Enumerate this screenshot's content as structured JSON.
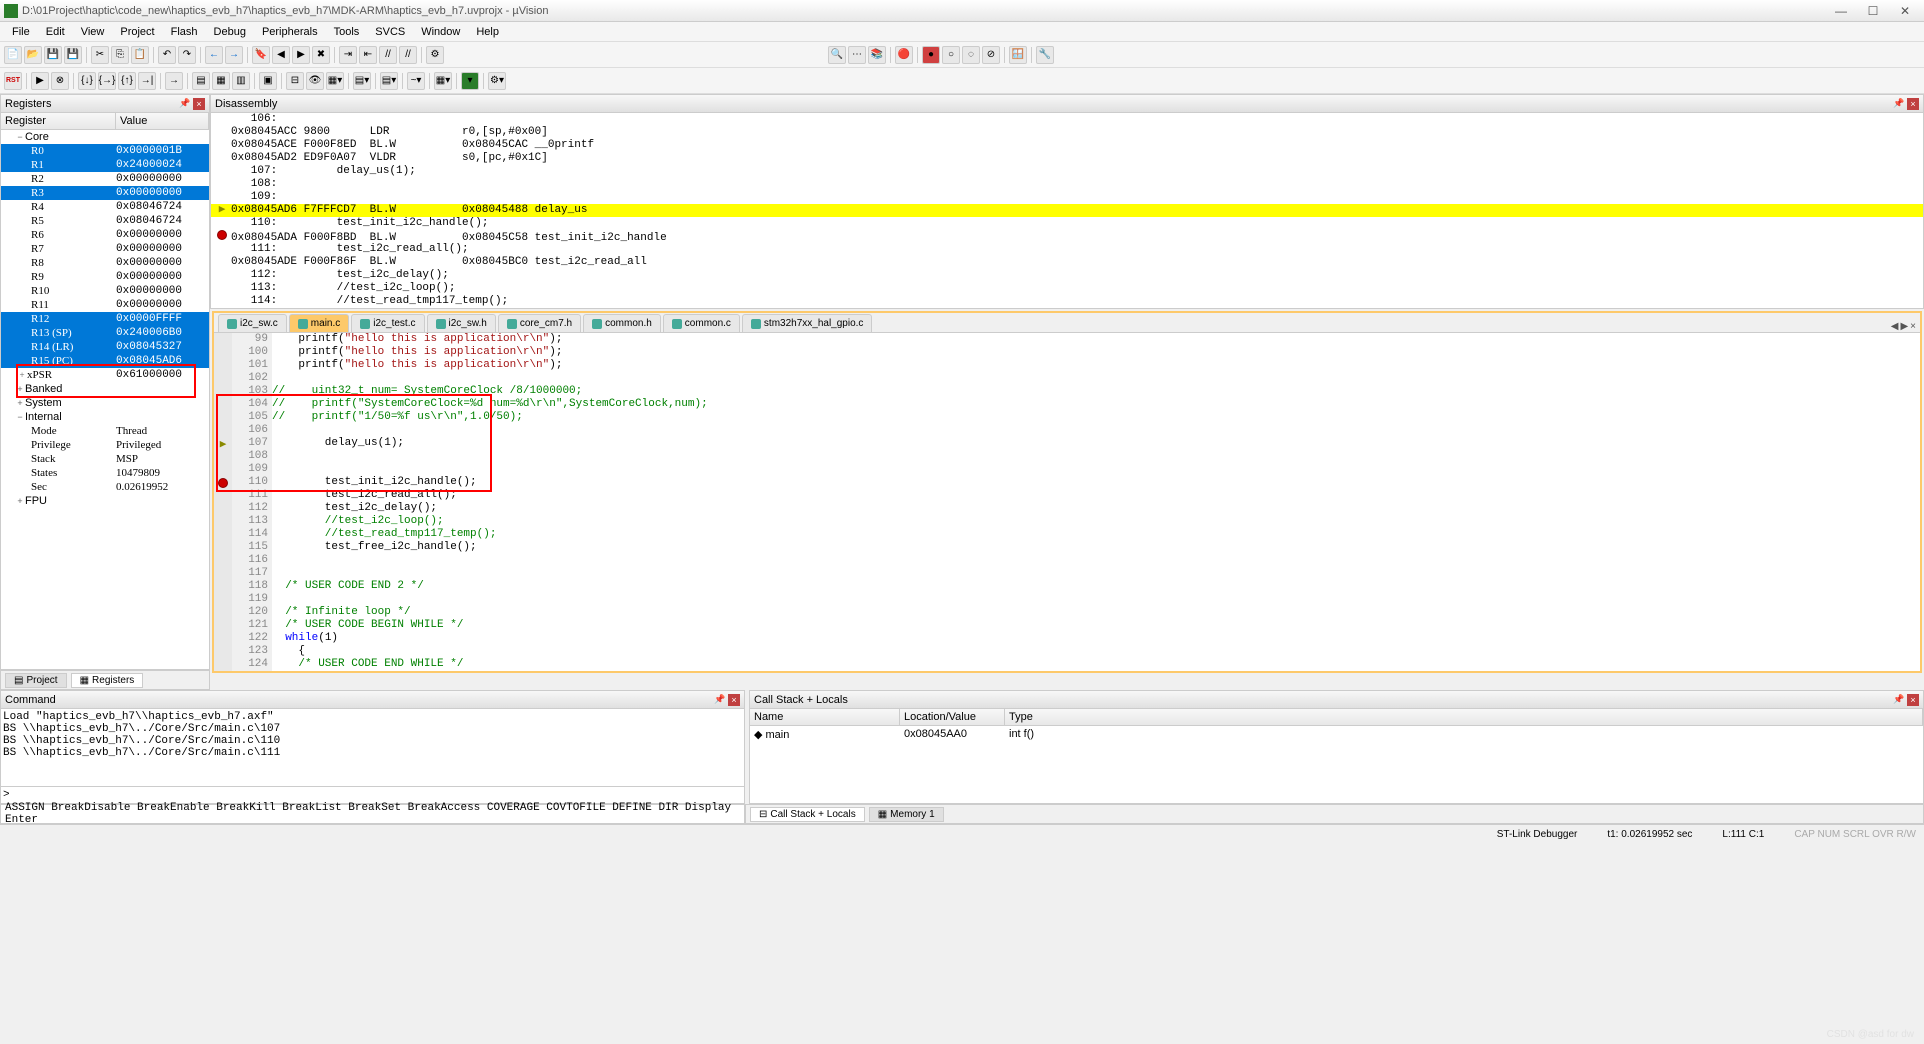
{
  "title": "D:\\01Project\\haptic\\code_new\\haptics_evb_h7\\haptics_evb_h7\\MDK-ARM\\haptics_evb_h7.uvprojx - µVision",
  "menu": [
    "File",
    "Edit",
    "View",
    "Project",
    "Flash",
    "Debug",
    "Peripherals",
    "Tools",
    "SVCS",
    "Window",
    "Help"
  ],
  "panels": {
    "registers": "Registers",
    "reg_col1": "Register",
    "reg_col2": "Value",
    "disassembly": "Disassembly",
    "command": "Command",
    "callstack": "Call Stack + Locals"
  },
  "reg_groups": {
    "core": "Core",
    "xpsr": "xPSR",
    "banked": "Banked",
    "system": "System",
    "internal": "Internal",
    "fpu": "FPU"
  },
  "registers": [
    {
      "name": "R0",
      "val": "0x0000001B",
      "sel": true
    },
    {
      "name": "R1",
      "val": "0x24000024",
      "sel": true
    },
    {
      "name": "R2",
      "val": "0x00000000",
      "sel": false
    },
    {
      "name": "R3",
      "val": "0x00000000",
      "sel": true
    },
    {
      "name": "R4",
      "val": "0x08046724",
      "sel": false
    },
    {
      "name": "R5",
      "val": "0x08046724",
      "sel": false
    },
    {
      "name": "R6",
      "val": "0x00000000",
      "sel": false
    },
    {
      "name": "R7",
      "val": "0x00000000",
      "sel": false
    },
    {
      "name": "R8",
      "val": "0x00000000",
      "sel": false
    },
    {
      "name": "R9",
      "val": "0x00000000",
      "sel": false
    },
    {
      "name": "R10",
      "val": "0x00000000",
      "sel": false
    },
    {
      "name": "R11",
      "val": "0x00000000",
      "sel": false
    },
    {
      "name": "R12",
      "val": "0x0000FFFF",
      "sel": true
    },
    {
      "name": "R13 (SP)",
      "val": "0x240006B0",
      "sel": true
    },
    {
      "name": "R14 (LR)",
      "val": "0x08045327",
      "sel": true
    },
    {
      "name": "R15 (PC)",
      "val": "0x08045AD6",
      "sel": true
    }
  ],
  "xpsr_val": "0x61000000",
  "internal": [
    {
      "name": "Mode",
      "val": "Thread"
    },
    {
      "name": "Privilege",
      "val": "Privileged"
    },
    {
      "name": "Stack",
      "val": "MSP"
    },
    {
      "name": "States",
      "val": "10479809"
    },
    {
      "name": "Sec",
      "val": "0.02619952"
    }
  ],
  "disasm": [
    {
      "txt": "   106:",
      "cls": ""
    },
    {
      "txt": "0x08045ACC 9800      LDR           r0,[sp,#0x00]",
      "cls": ""
    },
    {
      "txt": "0x08045ACE F000F8ED  BL.W          0x08045CAC __0printf",
      "cls": ""
    },
    {
      "txt": "0x08045AD2 ED9F0A07  VLDR          s0,[pc,#0x1C]",
      "cls": ""
    },
    {
      "txt": "   107:         delay_us(1);",
      "cls": ""
    },
    {
      "txt": "   108:",
      "cls": ""
    },
    {
      "txt": "   109:",
      "cls": ""
    },
    {
      "txt": "0x08045AD6 F7FFFCD7  BL.W          0x08045488 delay_us",
      "cls": "highlight",
      "cur": true
    },
    {
      "txt": "   110:         test_init_i2c_handle();",
      "cls": ""
    },
    {
      "txt": "0x08045ADA F000F8BD  BL.W          0x08045C58 test_init_i2c_handle",
      "cls": "",
      "bp": true
    },
    {
      "txt": "   111:         test_i2c_read_all();",
      "cls": ""
    },
    {
      "txt": "0x08045ADE F000F86F  BL.W          0x08045BC0 test_i2c_read_all",
      "cls": ""
    },
    {
      "txt": "   112:         test_i2c_delay();",
      "cls": ""
    },
    {
      "txt": "   113:         //test_i2c_loop();",
      "cls": ""
    },
    {
      "txt": "   114:         //test_read_tmp117_temp();",
      "cls": ""
    }
  ],
  "tabs": [
    "i2c_sw.c",
    "main.c",
    "i2c_test.c",
    "i2c_sw.h",
    "core_cm7.h",
    "common.h",
    "common.c",
    "stm32h7xx_hal_gpio.c"
  ],
  "active_tab": 1,
  "code": [
    {
      "n": 99,
      "t": "    printf(\"hello this is application\\r\\n\");"
    },
    {
      "n": 100,
      "t": "    printf(\"hello this is application\\r\\n\");"
    },
    {
      "n": 101,
      "t": "    printf(\"hello this is application\\r\\n\");"
    },
    {
      "n": 102,
      "t": ""
    },
    {
      "n": 103,
      "t": "//    uint32_t num= SystemCoreClock /8/1000000;",
      "c": "green"
    },
    {
      "n": 104,
      "t": "//    printf(\"SystemCoreClock=%d num=%d\\r\\n\",SystemCoreClock,num);",
      "c": "green"
    },
    {
      "n": 105,
      "t": "//    printf(\"1/50=%f us\\r\\n\",1.0/50);",
      "c": "green"
    },
    {
      "n": 106,
      "t": ""
    },
    {
      "n": 107,
      "t": "        delay_us(1);",
      "cur": true
    },
    {
      "n": 108,
      "t": ""
    },
    {
      "n": 109,
      "t": ""
    },
    {
      "n": 110,
      "t": "        test_init_i2c_handle();",
      "bp": true
    },
    {
      "n": 111,
      "t": "        test_i2c_read_all();"
    },
    {
      "n": 112,
      "t": "        test_i2c_delay();"
    },
    {
      "n": 113,
      "t": "        //test_i2c_loop();",
      "c": "green"
    },
    {
      "n": 114,
      "t": "        //test_read_tmp117_temp();",
      "c": "green"
    },
    {
      "n": 115,
      "t": "        test_free_i2c_handle();"
    },
    {
      "n": 116,
      "t": ""
    },
    {
      "n": 117,
      "t": ""
    },
    {
      "n": 118,
      "t": "  /* USER CODE END 2 */",
      "c": "green"
    },
    {
      "n": 119,
      "t": ""
    },
    {
      "n": 120,
      "t": "  /* Infinite loop */",
      "c": "green"
    },
    {
      "n": 121,
      "t": "  /* USER CODE BEGIN WHILE */",
      "c": "green"
    },
    {
      "n": 122,
      "t": "  while(1)",
      "kw": "while"
    },
    {
      "n": 123,
      "t": "    {"
    },
    {
      "n": 124,
      "t": "    /* USER CODE END WHILE */",
      "c": "green"
    }
  ],
  "bottom_tabs": {
    "project": "Project",
    "registers": "Registers"
  },
  "command_lines": [
    "Load \"haptics_evb_h7\\\\haptics_evb_h7.axf\"",
    "BS \\\\haptics_evb_h7\\../Core/Src/main.c\\107",
    "BS \\\\haptics_evb_h7\\../Core/Src/main.c\\110",
    "BS \\\\haptics_evb_h7\\../Core/Src/main.c\\111"
  ],
  "cmd_prompt": ">",
  "hints": "ASSIGN BreakDisable BreakEnable BreakKill BreakList BreakSet BreakAccess COVERAGE COVTOFILE DEFINE DIR Display Enter",
  "callstack": {
    "cols": [
      "Name",
      "Location/Value",
      "Type"
    ],
    "row": {
      "name": "main",
      "loc": "0x08045AA0",
      "type": "int f()"
    }
  },
  "cs_tabs": [
    "Call Stack + Locals",
    "Memory 1"
  ],
  "status": {
    "debugger": "ST-Link Debugger",
    "t1": "t1: 0.02619952 sec",
    "line": "L:111 C:1",
    "caps": "CAP NUM SCRL OVR R/W"
  }
}
